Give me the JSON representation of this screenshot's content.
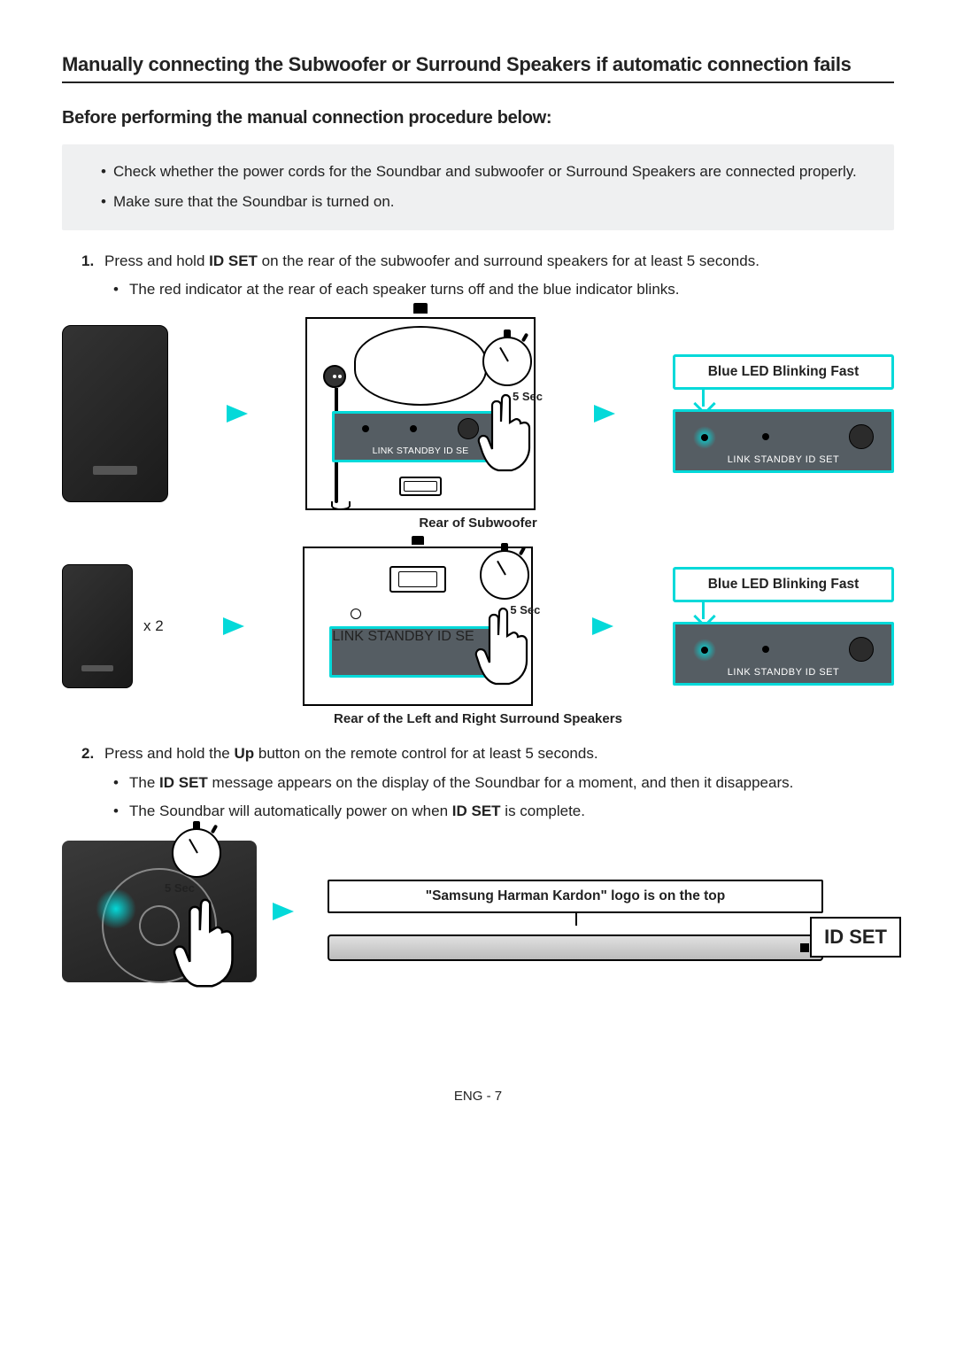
{
  "title": "Manually connecting the Subwoofer or Surround Speakers if automatic connection fails",
  "subtitle": "Before performing the manual connection procedure below:",
  "notes": [
    "Check whether the power cords for the Soundbar and subwoofer or Surround Speakers are connected properly.",
    "Make sure that the Soundbar is turned on."
  ],
  "step1": {
    "num": "1.",
    "text_pre": "Press and hold ",
    "bold1": "ID SET",
    "text_post": " on the rear of the subwoofer and surround speakers for at least 5 seconds.",
    "sub": "The red indicator at the rear of each speaker turns off and the blue indicator blinks."
  },
  "diagram": {
    "five_sec": "5 Sec",
    "led_labels": "LINK  STANDBY  ID SET",
    "led_labels_cut": "LINK  STANDBY  ID SE",
    "blue_blink": "Blue LED Blinking Fast",
    "caption1": "Rear of Subwoofer",
    "x2": "x 2",
    "caption2": "Rear of the Left and Right Surround Speakers"
  },
  "step2": {
    "num": "2.",
    "text_pre": "Press and hold the ",
    "bold1": "Up",
    "text_post": " button on the remote control for at least 5 seconds.",
    "sub1_pre": "The ",
    "sub1_bold": "ID SET",
    "sub1_post": " message appears on the display of the Soundbar for a moment, and then it disappears.",
    "sub2_pre": "The Soundbar will automatically power on when ",
    "sub2_bold": "ID SET",
    "sub2_post": " is complete."
  },
  "soundbar": {
    "callout": "\"Samsung Harman Kardon\" logo is on the top",
    "idset": "ID SET"
  },
  "page_num": "ENG - 7"
}
